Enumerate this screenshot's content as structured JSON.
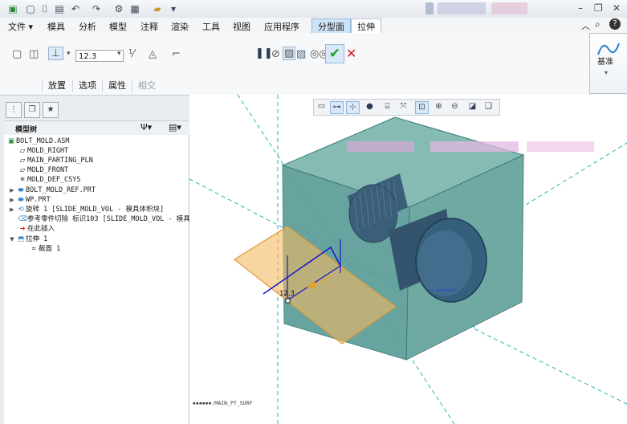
{
  "colors": {
    "accent": "#2f7fd1",
    "ribbon_active_tab": "#cfe3f7",
    "model_body": "#5aa6a0",
    "sketch_plane": "#f0b35a",
    "ok_green": "#1aa32c",
    "cancel_red": "#d22020",
    "dim_blue": "#1a1acc"
  },
  "quick_access": {
    "icons": [
      "new-icon",
      "open-icon",
      "save-icon",
      "undo-icon",
      "redo-icon",
      "regenerate-icon",
      "windows-icon",
      "close-window-icon"
    ]
  },
  "menu": {
    "file": "文件",
    "tabs": [
      "模具",
      "分析",
      "模型",
      "注释",
      "渲染",
      "工具",
      "视图",
      "应用程序",
      "分型面",
      "拉伸"
    ]
  },
  "ribbon": {
    "depth_value": "12.3",
    "subtabs": [
      "放置",
      "选项",
      "属性",
      "相交"
    ],
    "group_label": "基准"
  },
  "model_tree": {
    "title": "模型树",
    "items": [
      {
        "label": "BOLT_MOLD.ASM",
        "icon": "assembly-icon"
      },
      {
        "label": "MOLD_RIGHT",
        "icon": "datum-plane-icon"
      },
      {
        "label": "MAIN_PARTING_PLN",
        "icon": "datum-plane-icon"
      },
      {
        "label": "MOLD_FRONT",
        "icon": "datum-plane-icon"
      },
      {
        "label": "MOLD_DEF_CSYS",
        "icon": "csys-icon"
      },
      {
        "label": "BOLT_MOLD_REF.PRT",
        "icon": "part-icon"
      },
      {
        "label": "WP.PRT",
        "icon": "part-icon"
      },
      {
        "label": "旋转 1 [SLIDE_MOLD_VOL - 模具体积块]",
        "icon": "revolve-icon"
      },
      {
        "label": "参考零件切除 标识103 [SLIDE_MOLD_VOL - 模具",
        "icon": "cut-icon"
      },
      {
        "label": "在此插入",
        "icon": "insert-here-icon"
      },
      {
        "label": "拉伸 1",
        "icon": "extrude-icon"
      },
      {
        "label": "截面 1",
        "icon": "sketch-icon"
      }
    ]
  },
  "graphics": {
    "dimension": "12.3",
    "status_text": "MAIN_PT_SURF"
  }
}
